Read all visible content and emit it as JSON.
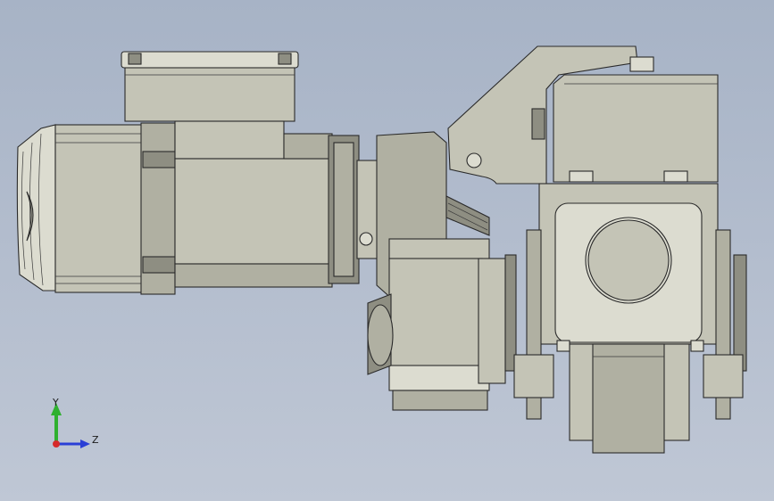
{
  "view": {
    "background_top": "#a7b3c6",
    "background_bottom": "#bfc7d5",
    "part_color": "#c4c4b6",
    "edge_color": "#2a2a2a"
  },
  "triad": {
    "y_label": "Y",
    "z_label": "Z",
    "y_color": "#2fb02f",
    "z_color": "#2a3fd6",
    "x_color": "#d62a2a"
  }
}
